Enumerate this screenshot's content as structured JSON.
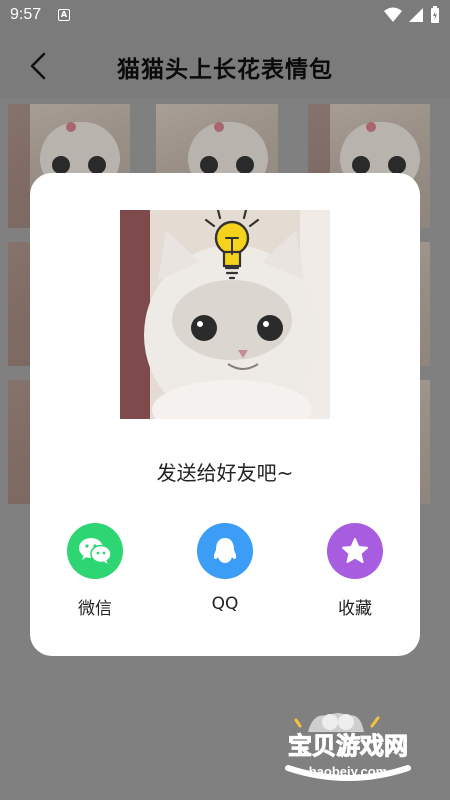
{
  "status_bar": {
    "time": "9:57",
    "notification_letter": "A"
  },
  "header": {
    "title": "猫猫头上长花表情包"
  },
  "dialog": {
    "prompt": "发送给好友吧~",
    "share_options": [
      {
        "label": "微信",
        "icon": "wechat-icon",
        "color": "#2ed573"
      },
      {
        "label": "QQ",
        "icon": "qq-icon",
        "color": "#3c9df6"
      },
      {
        "label": "收藏",
        "icon": "star-icon",
        "color": "#a85ce0"
      }
    ]
  },
  "watermark": {
    "brand": "宝贝游戏网",
    "domain": "baobeiy.com"
  }
}
